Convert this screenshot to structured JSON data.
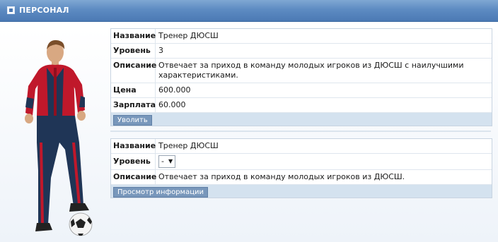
{
  "header": {
    "title": "ПЕРСОНАЛ"
  },
  "current_staff": {
    "rows": [
      {
        "label": "Название",
        "value": "Тренер ДЮСШ"
      },
      {
        "label": "Уровень",
        "value": "3"
      },
      {
        "label": "Описание",
        "value": "Отвечает за приход в команду молодых игроков из ДЮСШ с наилучшими характеристиками."
      },
      {
        "label": "Цена",
        "value": "600.000"
      },
      {
        "label": "Зарплата",
        "value": "60.000"
      }
    ],
    "fire_button": "Уволить"
  },
  "available_staff": {
    "name_label": "Название",
    "name_value": "Тренер ДЮСШ",
    "level_label": "Уровень",
    "level_selected": "-",
    "description_label": "Описание",
    "description_value": "Отвечает за приход в команду молодых игроков из ДЮСШ.",
    "info_button": "Просмотр информации"
  },
  "colors": {
    "header": "#5d8bc2",
    "button": "#7897bb",
    "footer_bar": "#d4e2ef",
    "kit_red": "#c0182b",
    "kit_navy": "#1f3556"
  },
  "icons": {
    "header_icon": "staff-icon",
    "figure": "coach-with-ball-illustration"
  }
}
